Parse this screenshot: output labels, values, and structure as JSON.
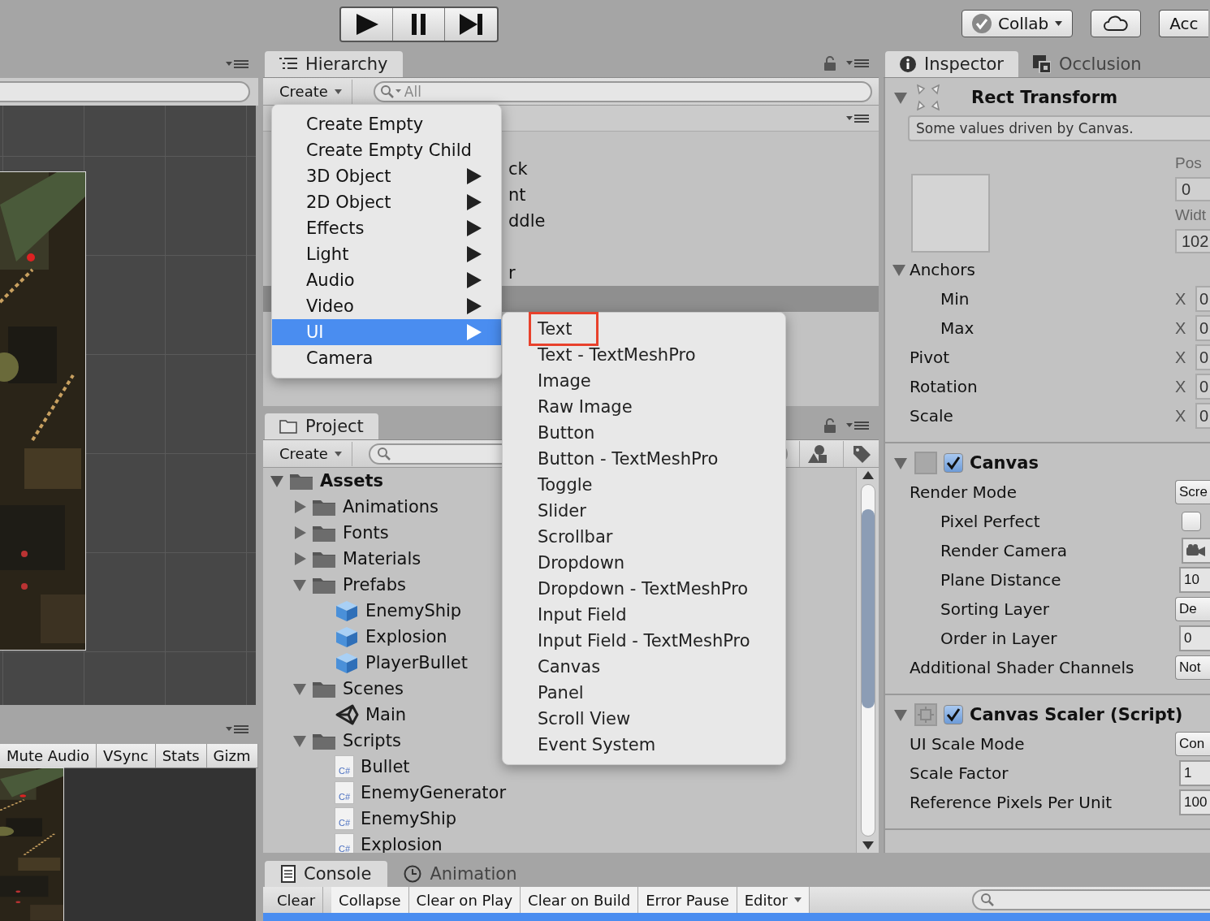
{
  "toolbar": {
    "play_buttons": [
      {
        "kind": "play"
      },
      {
        "kind": "pause"
      },
      {
        "kind": "step"
      }
    ],
    "collab": "Collab",
    "account": "Acc"
  },
  "game": {
    "toolbar": [
      "Mute Audio",
      "VSync",
      "Stats",
      "Gizm"
    ]
  },
  "hierarchy": {
    "tab": "Hierarchy",
    "create": "Create",
    "search_placeholder": "All",
    "rows": [
      {
        "label": "ck",
        "selected": false
      },
      {
        "label": "nt",
        "selected": false
      },
      {
        "label": "ddle",
        "selected": false
      },
      {
        "selected": false
      },
      {
        "label": "r",
        "selected": false
      },
      {
        "selected": true
      }
    ]
  },
  "create_menu": {
    "items": [
      {
        "label": "Create Empty",
        "submenu": false,
        "selected": false
      },
      {
        "label": "Create Empty Child",
        "submenu": false,
        "selected": false
      },
      {
        "label": "3D Object",
        "submenu": true,
        "selected": false
      },
      {
        "label": "2D Object",
        "submenu": true,
        "selected": false
      },
      {
        "label": "Effects",
        "submenu": true,
        "selected": false
      },
      {
        "label": "Light",
        "submenu": true,
        "selected": false
      },
      {
        "label": "Audio",
        "submenu": true,
        "selected": false
      },
      {
        "label": "Video",
        "submenu": true,
        "selected": false
      },
      {
        "label": "UI",
        "submenu": true,
        "selected": true
      },
      {
        "label": "Camera",
        "submenu": false,
        "selected": false
      }
    ]
  },
  "ui_submenu": {
    "items": [
      {
        "label": "Text",
        "outlined": true
      },
      {
        "label": "Text - TextMeshPro",
        "outlined": false
      },
      {
        "label": "Image",
        "outlined": false
      },
      {
        "label": "Raw Image",
        "outlined": false
      },
      {
        "label": "Button",
        "outlined": false
      },
      {
        "label": "Button - TextMeshPro",
        "outlined": false
      },
      {
        "label": "Toggle",
        "outlined": false
      },
      {
        "label": "Slider",
        "outlined": false
      },
      {
        "label": "Scrollbar",
        "outlined": false
      },
      {
        "label": "Dropdown",
        "outlined": false
      },
      {
        "label": "Dropdown - TextMeshPro",
        "outlined": false
      },
      {
        "label": "Input Field",
        "outlined": false
      },
      {
        "label": "Input Field - TextMeshPro",
        "outlined": false
      },
      {
        "label": "Canvas",
        "outlined": false
      },
      {
        "label": "Panel",
        "outlined": false
      },
      {
        "label": "Scroll View",
        "outlined": false
      },
      {
        "label": "Event System",
        "outlined": false
      }
    ]
  },
  "project": {
    "tab": "Project",
    "create": "Create",
    "tree": [
      {
        "label": "Assets",
        "kind": "folder",
        "expanded": true,
        "children": [
          {
            "label": "Animations",
            "kind": "folder",
            "expanded": false
          },
          {
            "label": "Fonts",
            "kind": "folder",
            "expanded": false
          },
          {
            "label": "Materials",
            "kind": "folder",
            "expanded": false
          },
          {
            "label": "Prefabs",
            "kind": "folder",
            "expanded": true,
            "children": [
              {
                "label": "EnemyShip",
                "kind": "prefab"
              },
              {
                "label": "Explosion",
                "kind": "prefab"
              },
              {
                "label": "PlayerBullet",
                "kind": "prefab"
              }
            ]
          },
          {
            "label": "Scenes",
            "kind": "folder",
            "expanded": true,
            "children": [
              {
                "label": "Main",
                "kind": "scene"
              }
            ]
          },
          {
            "label": "Scripts",
            "kind": "folder",
            "expanded": true,
            "children": [
              {
                "label": "Bullet",
                "kind": "script",
                "badge": "C#"
              },
              {
                "label": "EnemyGenerator",
                "kind": "script",
                "badge": "C#"
              },
              {
                "label": "EnemyShip",
                "kind": "script",
                "badge": "C#"
              },
              {
                "label": "Explosion",
                "kind": "script",
                "badge": "C#"
              }
            ]
          }
        ]
      }
    ]
  },
  "inspector": {
    "tabs": [
      {
        "label": "Inspector",
        "kind": "info",
        "selected": true
      },
      {
        "label": "Occlusion",
        "kind": "occlusion",
        "selected": false
      }
    ],
    "rect_transform": {
      "title": "Rect Transform",
      "expanded": true,
      "note": "Some values driven by Canvas.",
      "pos_label": "Pos",
      "pos_value": "0",
      "width_label": "Widt",
      "width_value": "102",
      "rows": [
        {
          "kind": "foldout",
          "label": "Anchors",
          "expanded": true,
          "children": [
            {
              "kind": "vector",
              "label": "Min",
              "axis": "X",
              "value": "0"
            },
            {
              "kind": "vector",
              "label": "Max",
              "axis": "X",
              "value": "0"
            }
          ]
        },
        {
          "kind": "vector",
          "label": "Pivot",
          "axis": "X",
          "value": "0"
        },
        {
          "kind": "vector",
          "label": "Rotation",
          "axis": "X",
          "value": "0"
        },
        {
          "kind": "vector",
          "label": "Scale",
          "axis": "X",
          "value": "0"
        }
      ]
    },
    "components": [
      {
        "title": "Canvas",
        "kind": "canvas",
        "enabled": true,
        "expanded": true,
        "rows": [
          {
            "kind": "dropdown",
            "label": "Render Mode",
            "value": "Scre",
            "children": [
              {
                "kind": "checkbox",
                "label": "Pixel Perfect",
                "checked": false
              },
              {
                "kind": "object",
                "label": "Render Camera"
              },
              {
                "kind": "field",
                "label": "Plane Distance",
                "value": "10"
              },
              {
                "kind": "dropdown",
                "label": "Sorting Layer",
                "value": "De"
              },
              {
                "kind": "field",
                "label": "Order in Layer",
                "value": "0"
              }
            ]
          },
          {
            "kind": "dropdown",
            "label": "Additional Shader Channels",
            "value": "Not"
          }
        ]
      },
      {
        "title": "Canvas Scaler (Script)",
        "kind": "scaler",
        "enabled": true,
        "expanded": true,
        "rows": [
          {
            "kind": "dropdown",
            "label": "UI Scale Mode",
            "value": "Con"
          },
          {
            "kind": "field",
            "label": "Scale Factor",
            "value": "1"
          },
          {
            "kind": "field",
            "label": "Reference Pixels Per Unit",
            "value": "100"
          }
        ]
      }
    ]
  },
  "console": {
    "tabs": [
      {
        "label": "Console",
        "kind": "console",
        "selected": true
      },
      {
        "label": "Animation",
        "kind": "animation",
        "selected": false
      }
    ],
    "buttons": [
      {
        "label": "Clear",
        "dropdown": false
      },
      {
        "label": "Collapse",
        "dropdown": false
      },
      {
        "label": "Clear on Play",
        "dropdown": false
      },
      {
        "label": "Clear on Build",
        "dropdown": false
      },
      {
        "label": "Error Pause",
        "dropdown": false
      },
      {
        "label": "Editor",
        "dropdown": true
      }
    ]
  }
}
